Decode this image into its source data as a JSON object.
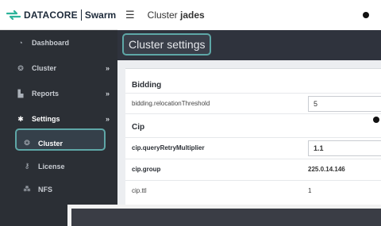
{
  "brand": {
    "name": "DATACORE",
    "product": "Swarm",
    "accent_color": "#2bb39a"
  },
  "sidebar": {
    "items": [
      {
        "label": "Dashboard",
        "icon": "dashboard-icon",
        "chevron": ""
      },
      {
        "label": "Cluster",
        "icon": "cluster-icon",
        "chevron": "»"
      },
      {
        "label": "Reports",
        "icon": "reports-icon",
        "chevron": "»"
      },
      {
        "label": "Settings",
        "icon": "gear-icon",
        "chevron": "»"
      },
      {
        "label": "Cluster",
        "icon": "cluster-icon",
        "chevron": ""
      },
      {
        "label": "License",
        "icon": "key-icon",
        "chevron": ""
      },
      {
        "label": "NFS",
        "icon": "network-icon",
        "chevron": ""
      }
    ],
    "active_item": "Cluster"
  },
  "topbar": {
    "prefix": "Cluster",
    "name": "jades"
  },
  "page": {
    "title": "Cluster settings"
  },
  "sections": [
    {
      "title": "Bidding",
      "rows": [
        {
          "key": "bidding.relocationThreshold",
          "value": "5",
          "type": "input",
          "bold": false
        }
      ]
    },
    {
      "title": "Cip",
      "rows": [
        {
          "key": "cip.queryRetryMultiplier",
          "value": "1.1",
          "type": "input",
          "bold": true
        },
        {
          "key": "cip.group",
          "value": "225.0.14.146",
          "type": "text",
          "bold": true
        },
        {
          "key": "cip.ttl",
          "value": "1",
          "type": "text",
          "bold": false
        }
      ]
    }
  ]
}
